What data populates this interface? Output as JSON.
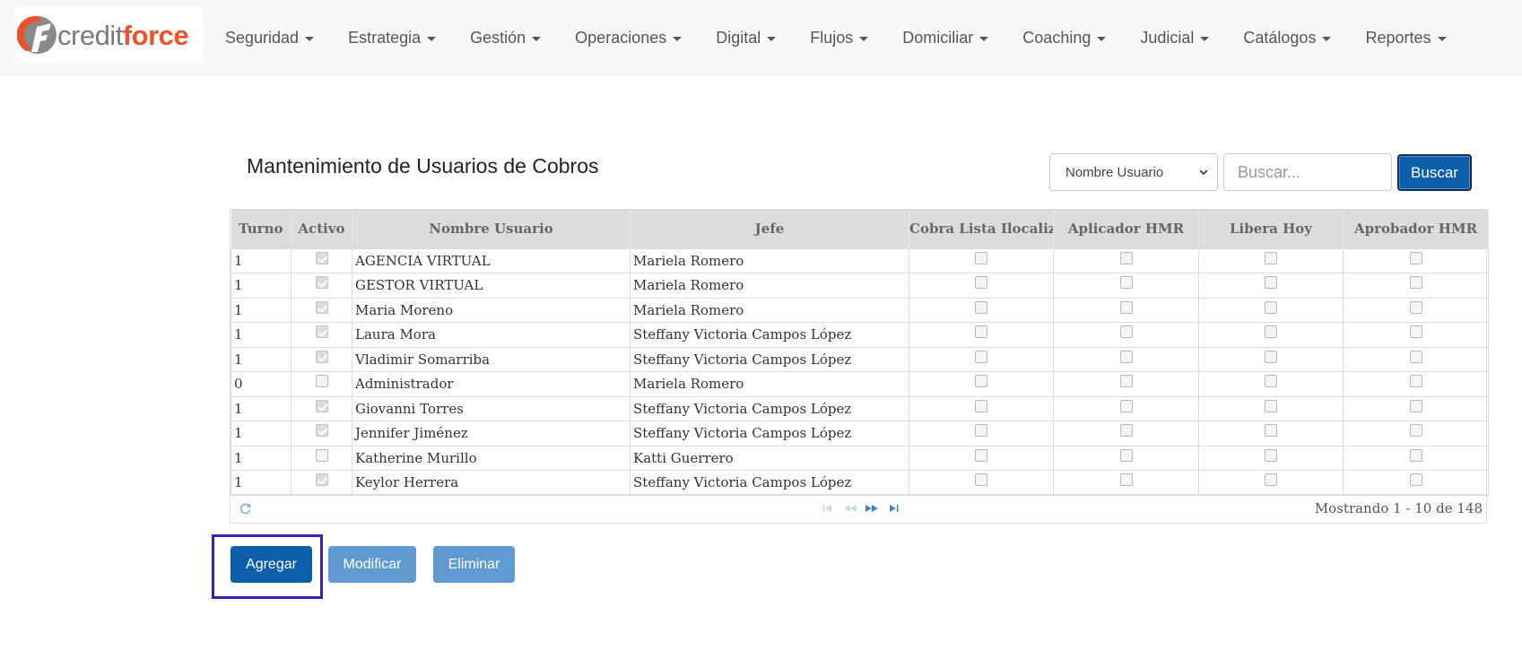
{
  "brand": {
    "credit": "credit",
    "force": "force"
  },
  "nav": [
    {
      "label": "Seguridad",
      "name": "seguridad"
    },
    {
      "label": "Estrategia",
      "name": "estrategia"
    },
    {
      "label": "Gestión",
      "name": "gestion"
    },
    {
      "label": "Operaciones",
      "name": "operaciones"
    },
    {
      "label": "Digital",
      "name": "digital"
    },
    {
      "label": "Flujos",
      "name": "flujos"
    },
    {
      "label": "Domiciliar",
      "name": "domiciliar"
    },
    {
      "label": "Coaching",
      "name": "coaching"
    },
    {
      "label": "Judicial",
      "name": "judicial"
    },
    {
      "label": "Catálogos",
      "name": "catalogos"
    },
    {
      "label": "Reportes",
      "name": "reportes"
    }
  ],
  "page": {
    "title": "Mantenimiento de Usuarios de Cobros"
  },
  "search": {
    "filter_selected": "Nombre Usuario",
    "placeholder": "Buscar...",
    "value": "",
    "button_label": "Buscar"
  },
  "table": {
    "columns": [
      "Turno",
      "Activo",
      "Nombre Usuario",
      "Jefe",
      "Cobra Lista Ilocaliz",
      "Aplicador HMR",
      "Libera Hoy",
      "Aprobador HMR"
    ],
    "rows": [
      {
        "turno": "1",
        "activo": true,
        "nombre": "AGENCIA VIRTUAL",
        "jefe": "Mariela Romero",
        "cobra": false,
        "aplicador": false,
        "libera": false,
        "aprobador": false
      },
      {
        "turno": "1",
        "activo": true,
        "nombre": "GESTOR VIRTUAL",
        "jefe": "Mariela Romero",
        "cobra": false,
        "aplicador": false,
        "libera": false,
        "aprobador": false
      },
      {
        "turno": "1",
        "activo": true,
        "nombre": "Maria Moreno",
        "jefe": "Mariela Romero",
        "cobra": false,
        "aplicador": false,
        "libera": false,
        "aprobador": false
      },
      {
        "turno": "1",
        "activo": true,
        "nombre": "Laura Mora",
        "jefe": "Steffany Victoria Campos López",
        "cobra": false,
        "aplicador": false,
        "libera": false,
        "aprobador": false
      },
      {
        "turno": "1",
        "activo": true,
        "nombre": "Vladimir Somarriba",
        "jefe": "Steffany Victoria Campos López",
        "cobra": false,
        "aplicador": false,
        "libera": false,
        "aprobador": false
      },
      {
        "turno": "0",
        "activo": false,
        "nombre": "Administrador",
        "jefe": "Mariela Romero",
        "cobra": false,
        "aplicador": false,
        "libera": false,
        "aprobador": false
      },
      {
        "turno": "1",
        "activo": true,
        "nombre": "Giovanni Torres",
        "jefe": "Steffany Victoria Campos López",
        "cobra": false,
        "aplicador": false,
        "libera": false,
        "aprobador": false
      },
      {
        "turno": "1",
        "activo": true,
        "nombre": "Jennifer Jiménez",
        "jefe": "Steffany Victoria Campos López",
        "cobra": false,
        "aplicador": false,
        "libera": false,
        "aprobador": false
      },
      {
        "turno": "1",
        "activo": false,
        "nombre": "Katherine Murillo",
        "jefe": "Katti Guerrero",
        "cobra": false,
        "aplicador": false,
        "libera": false,
        "aprobador": false
      },
      {
        "turno": "1",
        "activo": true,
        "nombre": "Keylor Herrera",
        "jefe": "Steffany Victoria Campos López",
        "cobra": false,
        "aplicador": false,
        "libera": false,
        "aprobador": false
      }
    ]
  },
  "pager": {
    "summary": "Mostrando 1 - 10 de 148"
  },
  "actions": {
    "add": "Agregar",
    "modify": "Modificar",
    "delete": "Eliminar"
  },
  "colors": {
    "primary": "#0d5fab",
    "secondary": "#5f9bd0",
    "brand_orange": "#e8552a",
    "highlight": "#3c1fb0"
  }
}
